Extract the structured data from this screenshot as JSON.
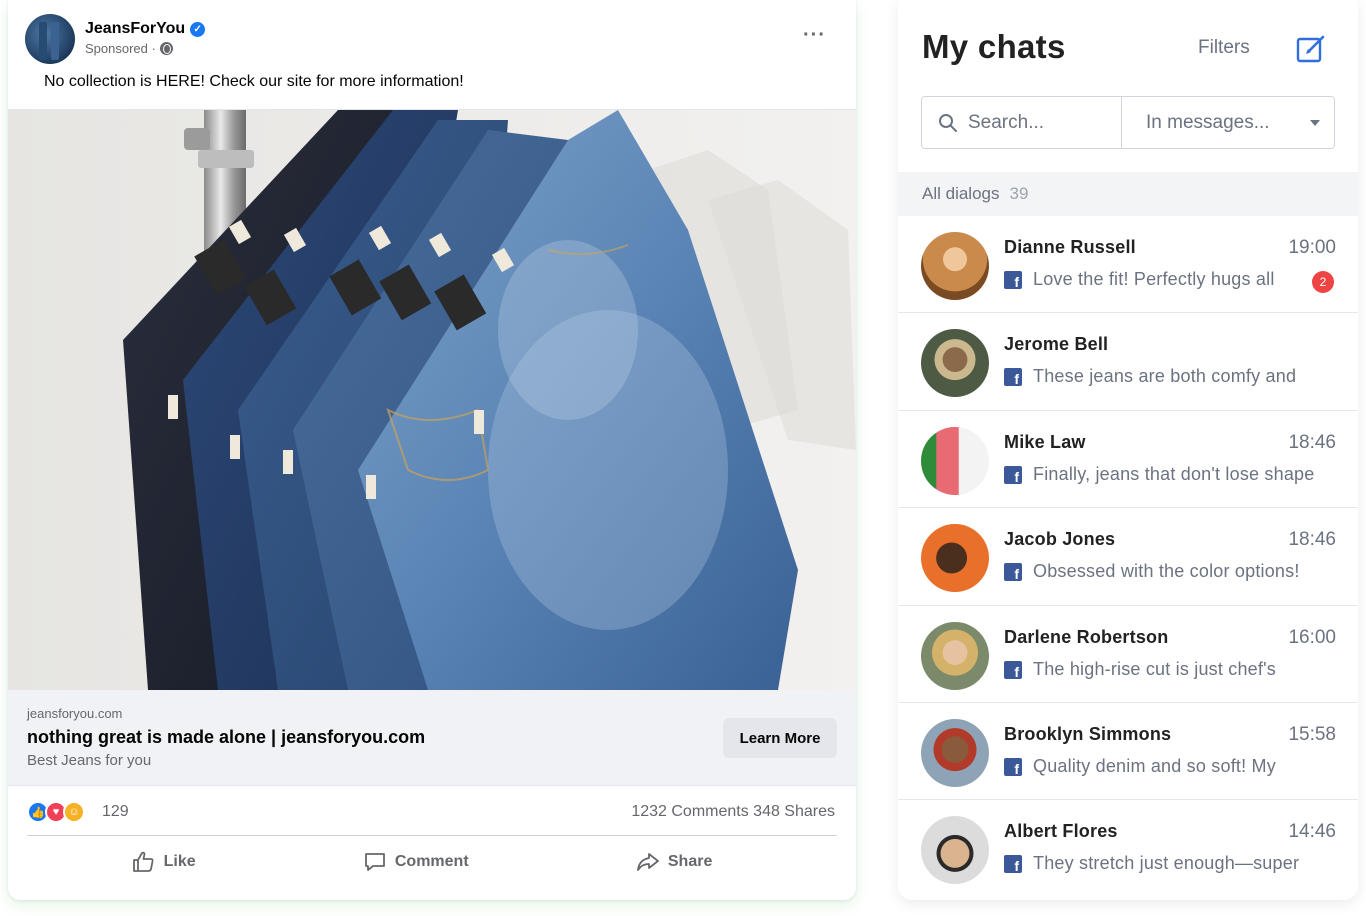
{
  "post": {
    "page_name": "JeansForYou",
    "verified_icon": "verified-badge-icon",
    "sponsored": "Sponsored ·",
    "text": "No collection is HERE! Check our site for more information!",
    "link": {
      "domain": "jeansforyou.com",
      "title": "nothing great is made alone | jeansforyou.com",
      "description": "Best Jeans for you",
      "cta": "Learn More"
    },
    "reactions": {
      "count": "129",
      "comments_shares": "1232 Comments  348 Shares",
      "types": [
        "like",
        "love",
        "care"
      ]
    },
    "actions": {
      "like": "Like",
      "comment": "Comment",
      "share": "Share"
    }
  },
  "chats": {
    "title": "My chats",
    "filters": "Filters",
    "search_placeholder": "Search...",
    "scope_select": "In messages...",
    "dialogs_label": "All dialogs",
    "dialogs_count": "39",
    "items": [
      {
        "name": "Dianne Russell",
        "time": "19:00",
        "message": "Love the fit! Perfectly hugs all",
        "unread": "2",
        "avatar_color": "#c98a4b"
      },
      {
        "name": "Jerome Bell",
        "time": "",
        "message": "These jeans are both comfy and",
        "unread": "",
        "avatar_color": "#6b5a3e"
      },
      {
        "name": "Mike Law",
        "time": "18:46",
        "message": "Finally, jeans that don't lose shape",
        "unread": "",
        "avatar_color": "#e86a72"
      },
      {
        "name": "Jacob Jones",
        "time": "18:46",
        "message": "Obsessed with the color options!",
        "unread": "",
        "avatar_color": "#e8702a"
      },
      {
        "name": "Darlene Robertson",
        "time": "16:00",
        "message": "The high-rise cut is just chef's",
        "unread": "",
        "avatar_color": "#d4b26a"
      },
      {
        "name": "Brooklyn Simmons",
        "time": "15:58",
        "message": "Quality denim and so soft! My",
        "unread": "",
        "avatar_color": "#8a5a3c"
      },
      {
        "name": "Albert Flores",
        "time": "14:46",
        "message": "They stretch just enough—super",
        "unread": "",
        "avatar_color": "#d9c4a8"
      }
    ]
  }
}
